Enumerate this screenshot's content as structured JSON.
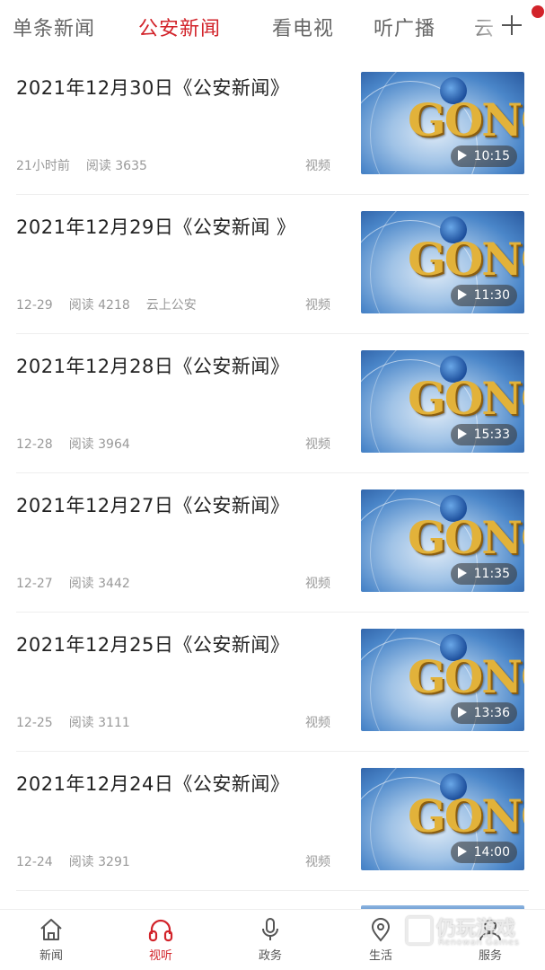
{
  "tabs": [
    {
      "label": "单条新闻",
      "active": false
    },
    {
      "label": "公安新闻",
      "active": true
    },
    {
      "label": "看电视",
      "active": false
    },
    {
      "label": "听广播",
      "active": false
    },
    {
      "label": "云",
      "active": false
    }
  ],
  "colors": {
    "accent": "#d2232a",
    "text": "#222222",
    "meta": "#999999"
  },
  "items": [
    {
      "title": "2021年12月30日《公安新闻》",
      "time": "21小时前",
      "reads": "阅读 3635",
      "source": "",
      "type": "视频",
      "duration": "10:15"
    },
    {
      "title": "2021年12月29日《公安新闻 》",
      "time": "12-29",
      "reads": "阅读 4218",
      "source": "云上公安",
      "type": "视频",
      "duration": "11:30"
    },
    {
      "title": "2021年12月28日《公安新闻》",
      "time": "12-28",
      "reads": "阅读 3964",
      "source": "",
      "type": "视频",
      "duration": "15:33"
    },
    {
      "title": "2021年12月27日《公安新闻》",
      "time": "12-27",
      "reads": "阅读 3442",
      "source": "",
      "type": "视频",
      "duration": "11:35"
    },
    {
      "title": "2021年12月25日《公安新闻》",
      "time": "12-25",
      "reads": "阅读 3111",
      "source": "",
      "type": "视频",
      "duration": "13:36"
    },
    {
      "title": "2021年12月24日《公安新闻》",
      "time": "12-24",
      "reads": "阅读 3291",
      "source": "",
      "type": "视频",
      "duration": "14:00"
    }
  ],
  "thumb_logo": "GONG",
  "bottom_nav": [
    {
      "label": "新闻",
      "icon": "home-icon",
      "active": false
    },
    {
      "label": "视听",
      "icon": "headphones-icon",
      "active": true
    },
    {
      "label": "政务",
      "icon": "microphone-icon",
      "active": false
    },
    {
      "label": "生活",
      "icon": "location-pin-icon",
      "active": false
    },
    {
      "label": "服务",
      "icon": "service-icon",
      "active": false
    }
  ],
  "watermark": {
    "text": "仍玩游戏",
    "sub": "Renowan Games"
  }
}
